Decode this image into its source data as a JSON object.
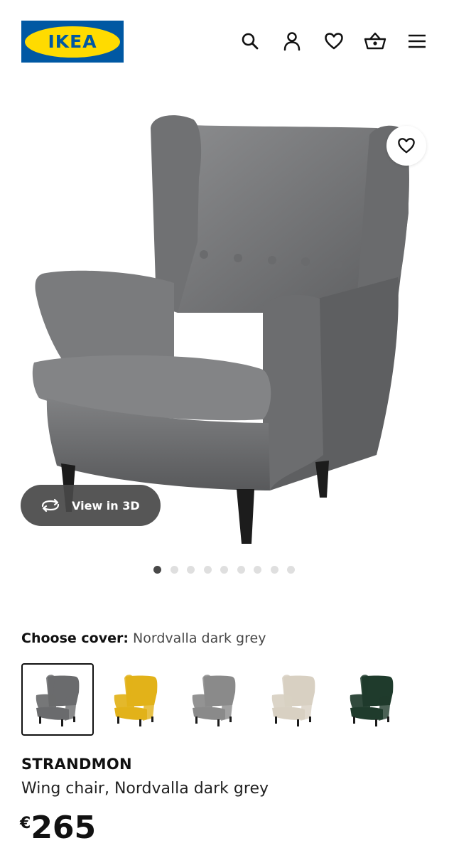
{
  "brand": {
    "logo_text": "IKEA",
    "blue": "#0058a3",
    "yellow": "#ffdb00"
  },
  "header": {
    "icons": [
      "search-icon",
      "account-icon",
      "heart-icon",
      "basket-icon",
      "menu-icon"
    ]
  },
  "gallery": {
    "view3d_label": "View in 3D",
    "dot_count": 9,
    "active_dot": 1
  },
  "cover": {
    "label": "Choose cover:",
    "value": "Nordvalla dark grey",
    "options": [
      {
        "color": "#6a6b6d",
        "selected": true
      },
      {
        "color": "#e2b219",
        "selected": false
      },
      {
        "color": "#8a8a8a",
        "selected": false
      },
      {
        "color": "#d8d0c2",
        "selected": false
      },
      {
        "color": "#1f3b2c",
        "selected": false
      }
    ]
  },
  "product": {
    "name": "STRANDMON",
    "description": "Wing chair, Nordvalla dark grey",
    "currency": "€",
    "price": "265"
  }
}
